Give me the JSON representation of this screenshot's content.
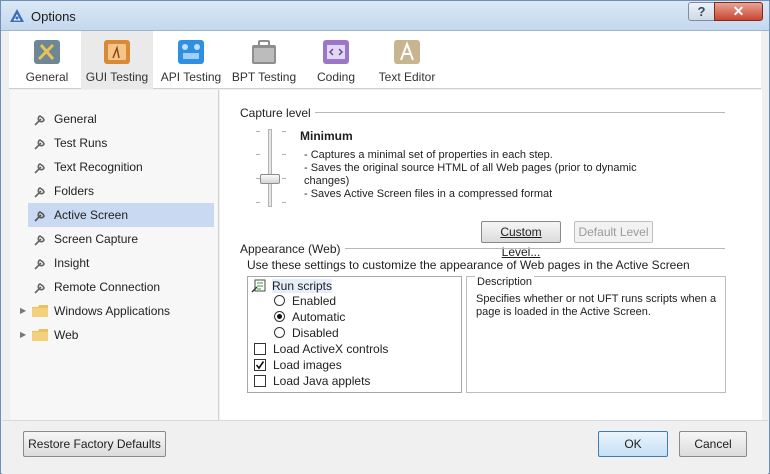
{
  "window": {
    "title": "Options",
    "help_glyph": "?",
    "close_glyph": "✕"
  },
  "tabs": [
    {
      "label": "General",
      "icon": "tools-icon",
      "active": false
    },
    {
      "label": "GUI Testing",
      "icon": "gui-testing-icon",
      "active": true
    },
    {
      "label": "API Testing",
      "icon": "api-testing-icon",
      "active": false
    },
    {
      "label": "BPT Testing",
      "icon": "bpt-testing-icon",
      "active": false
    },
    {
      "label": "Coding",
      "icon": "coding-icon",
      "active": false
    },
    {
      "label": "Text Editor",
      "icon": "text-editor-icon",
      "active": false
    }
  ],
  "sidebar": {
    "items": [
      {
        "label": "General",
        "icon": "wrench-icon"
      },
      {
        "label": "Test Runs",
        "icon": "wrench-icon"
      },
      {
        "label": "Text Recognition",
        "icon": "wrench-icon"
      },
      {
        "label": "Folders",
        "icon": "wrench-icon"
      },
      {
        "label": "Active Screen",
        "icon": "wrench-icon",
        "selected": true
      },
      {
        "label": "Screen Capture",
        "icon": "wrench-icon"
      },
      {
        "label": "Insight",
        "icon": "wrench-icon"
      },
      {
        "label": "Remote Connection",
        "icon": "wrench-icon"
      },
      {
        "label": "Windows Applications",
        "icon": "folder-icon",
        "expandable": true
      },
      {
        "label": "Web",
        "icon": "folder-icon",
        "expandable": true
      }
    ]
  },
  "capture": {
    "section_title": "Capture level",
    "level_name": "Minimum",
    "description": [
      "- Captures a minimal set of properties in each step.",
      "- Saves the original source HTML of all Web pages (prior to dynamic",
      "changes)",
      "- Saves Active Screen files in a compressed format"
    ],
    "custom_button": "Custom Level...",
    "default_button": "Default Level"
  },
  "appearance": {
    "section_title": "Appearance (Web)",
    "intro": "Use these settings to customize the appearance of Web pages in the Active Screen",
    "options": {
      "run_scripts": "Run scripts",
      "enabled": "Enabled",
      "automatic": "Automatic",
      "disabled": "Disabled",
      "load_activex": "Load ActiveX controls",
      "load_images": "Load images",
      "load_java": "Load Java applets"
    },
    "description_title": "Description",
    "description_text": [
      "Specifies whether or not UFT runs scripts when a",
      "page is loaded in the Active Screen."
    ]
  },
  "footer": {
    "restore_button": "Restore Factory Defaults",
    "ok_button": "OK",
    "cancel_button": "Cancel"
  }
}
